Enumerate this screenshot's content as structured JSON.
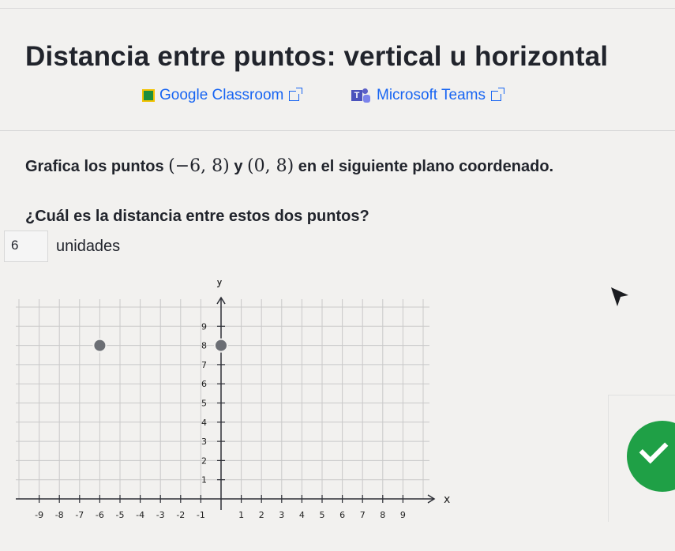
{
  "title": "Distancia entre puntos: vertical u horizontal",
  "integrations": {
    "google_classroom": "Google Classroom",
    "microsoft_teams": "Microsoft Teams"
  },
  "problem": {
    "prompt_prefix": "Grafica los puntos",
    "point1": "(−6, 8)",
    "conj": "y",
    "point2": "(0, 8)",
    "prompt_suffix": "en el siguiente plano coordenado.",
    "question": "¿Cuál es la distancia entre estos dos puntos?",
    "answer_value": "6",
    "unit_label": "unidades"
  },
  "graph": {
    "x_axis_label": "x",
    "y_axis_label": "y",
    "x_range": [
      -10,
      10
    ],
    "y_range": [
      0,
      10
    ],
    "x_tick_labels": [
      -9,
      -8,
      -7,
      -6,
      -5,
      -4,
      -3,
      -2,
      -1,
      1,
      2,
      3,
      4,
      5,
      6,
      7,
      8,
      9
    ],
    "y_tick_labels": [
      1,
      2,
      3,
      4,
      5,
      6,
      7,
      8,
      9
    ],
    "points": [
      {
        "x": -6,
        "y": 8
      },
      {
        "x": 0,
        "y": 8
      }
    ],
    "colors": {
      "grid": "#c9c9c9",
      "axis": "#2d2f36",
      "point": "#6b6e74"
    }
  },
  "status": {
    "check_color": "#1fa046"
  }
}
